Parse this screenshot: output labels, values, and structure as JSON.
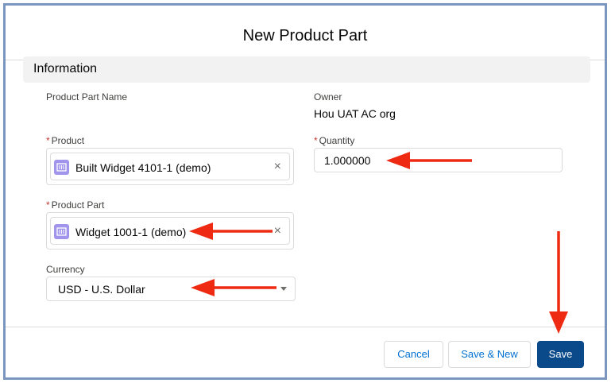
{
  "modal": {
    "title": "New Product Part"
  },
  "section": {
    "title": "Information"
  },
  "fields": {
    "product_part_name": {
      "label": "Product Part Name"
    },
    "owner": {
      "label": "Owner",
      "value": "Hou UAT AC org"
    },
    "product": {
      "label": "Product",
      "required_marker": "*",
      "value": "Built Widget 4101-1 (demo)"
    },
    "quantity": {
      "label": "Quantity",
      "required_marker": "*",
      "value": "1.000000"
    },
    "product_part": {
      "label": "Product Part",
      "required_marker": "*",
      "value": "Widget 1001-1 (demo)"
    },
    "currency": {
      "label": "Currency",
      "value": "USD - U.S. Dollar"
    }
  },
  "icons": {
    "remove": "×"
  },
  "footer": {
    "cancel_label": "Cancel",
    "save_new_label": "Save & New",
    "save_label": "Save"
  },
  "colors": {
    "annotation_arrow": "#ee2b12",
    "primary_button": "#0b4a8a",
    "record_icon": "#a094ed"
  }
}
